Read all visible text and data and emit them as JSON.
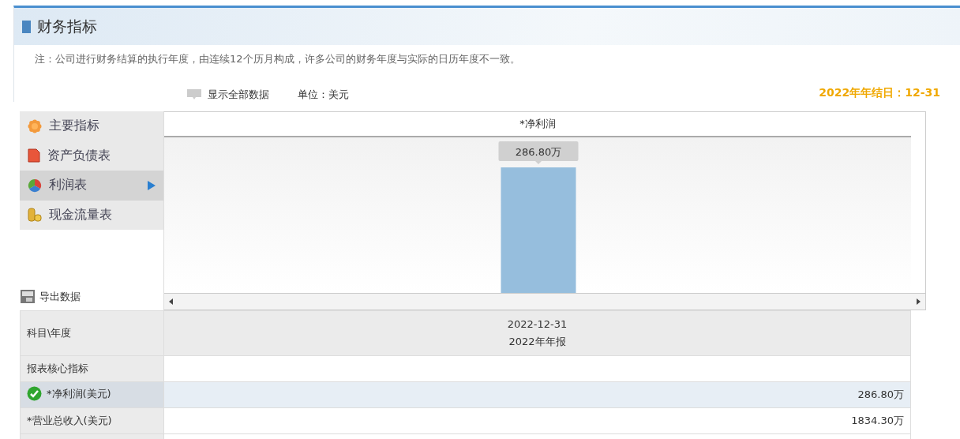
{
  "header": {
    "title": "财务指标"
  },
  "note": "注：公司进行财务结算的执行年度，由连续12个历月构成，许多公司的财务年度与实际的日历年度不一致。",
  "toolbar": {
    "show_all": "显示全部数据",
    "unit": "单位：美元",
    "year_end": "2022年年结日：12-31"
  },
  "sidebar": {
    "items": [
      {
        "label": "主要指标",
        "selected": false
      },
      {
        "label": "资产负债表",
        "selected": false
      },
      {
        "label": "利润表",
        "selected": true
      },
      {
        "label": "现金流量表",
        "selected": false
      }
    ]
  },
  "export": "导出数据",
  "chart": {
    "title": "*净利润",
    "bar_label": "286.80万"
  },
  "table": {
    "columns": [
      {
        "label": "科目\\年度"
      },
      {
        "date": "2022-12-31",
        "label": "2022年年报"
      }
    ],
    "rows": [
      {
        "kind": "section",
        "label": "报表核心指标"
      },
      {
        "kind": "metric",
        "label": "*净利润(美元)",
        "value": "286.80万",
        "selected": true
      },
      {
        "kind": "metric",
        "label": "*营业总收入(美元)",
        "value": "1834.30万",
        "selected": false
      }
    ]
  }
}
